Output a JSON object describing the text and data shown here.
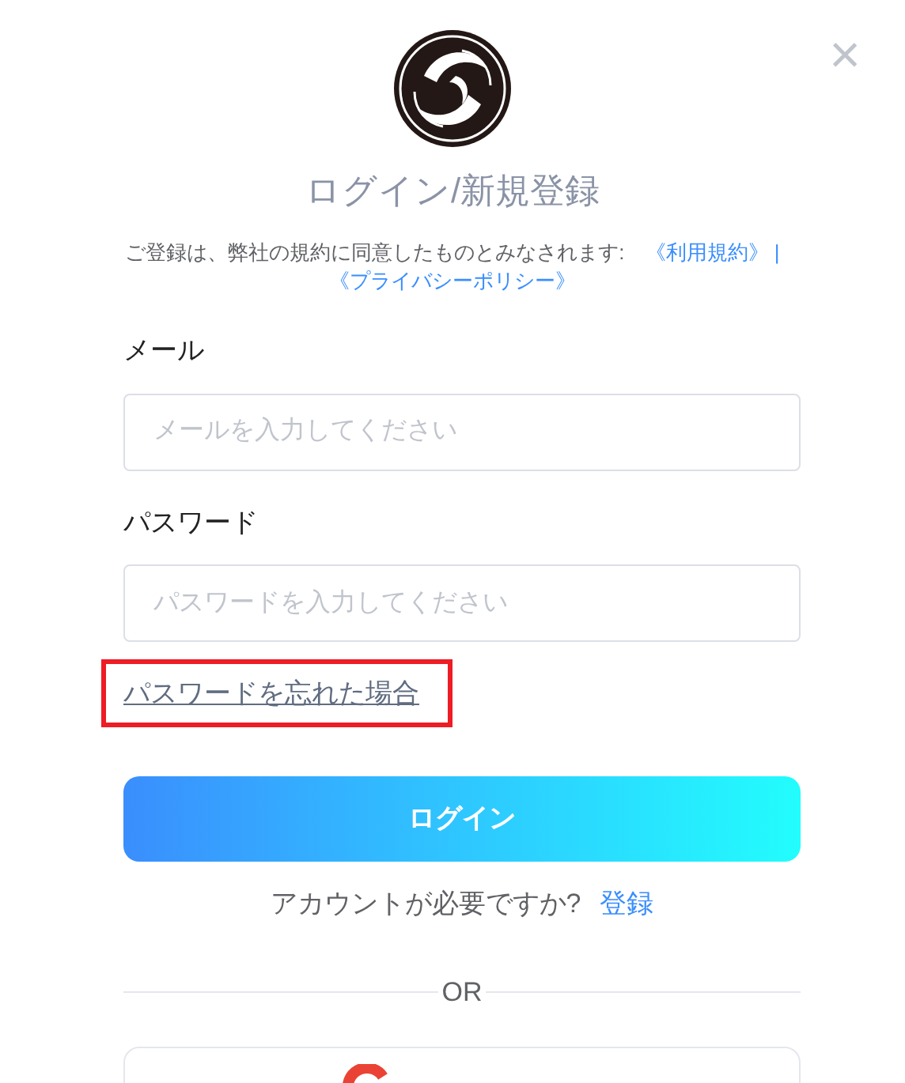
{
  "dialog": {
    "title": "ログイン/新規登録",
    "close": "×"
  },
  "terms": {
    "text": "ご登録は、弊社の規約に同意したものとみなされます:",
    "links": [
      "《利用規約》",
      "《プライバシーポリシー》"
    ],
    "separator": "|"
  },
  "fields": [
    {
      "label": "メール",
      "placeholder": "メールを入力してください"
    },
    {
      "label": "パスワード",
      "placeholder": "パスワードを入力してください"
    }
  ],
  "forgot_link": {
    "text": "パスワードを忘れた場合",
    "highlighted": true
  },
  "login_button": "ログイン",
  "signup": {
    "prompt": "アカウントが必要ですか?",
    "link": "登録"
  },
  "divider": "OR",
  "social_buttons": [
    {
      "kind": "google"
    }
  ]
}
